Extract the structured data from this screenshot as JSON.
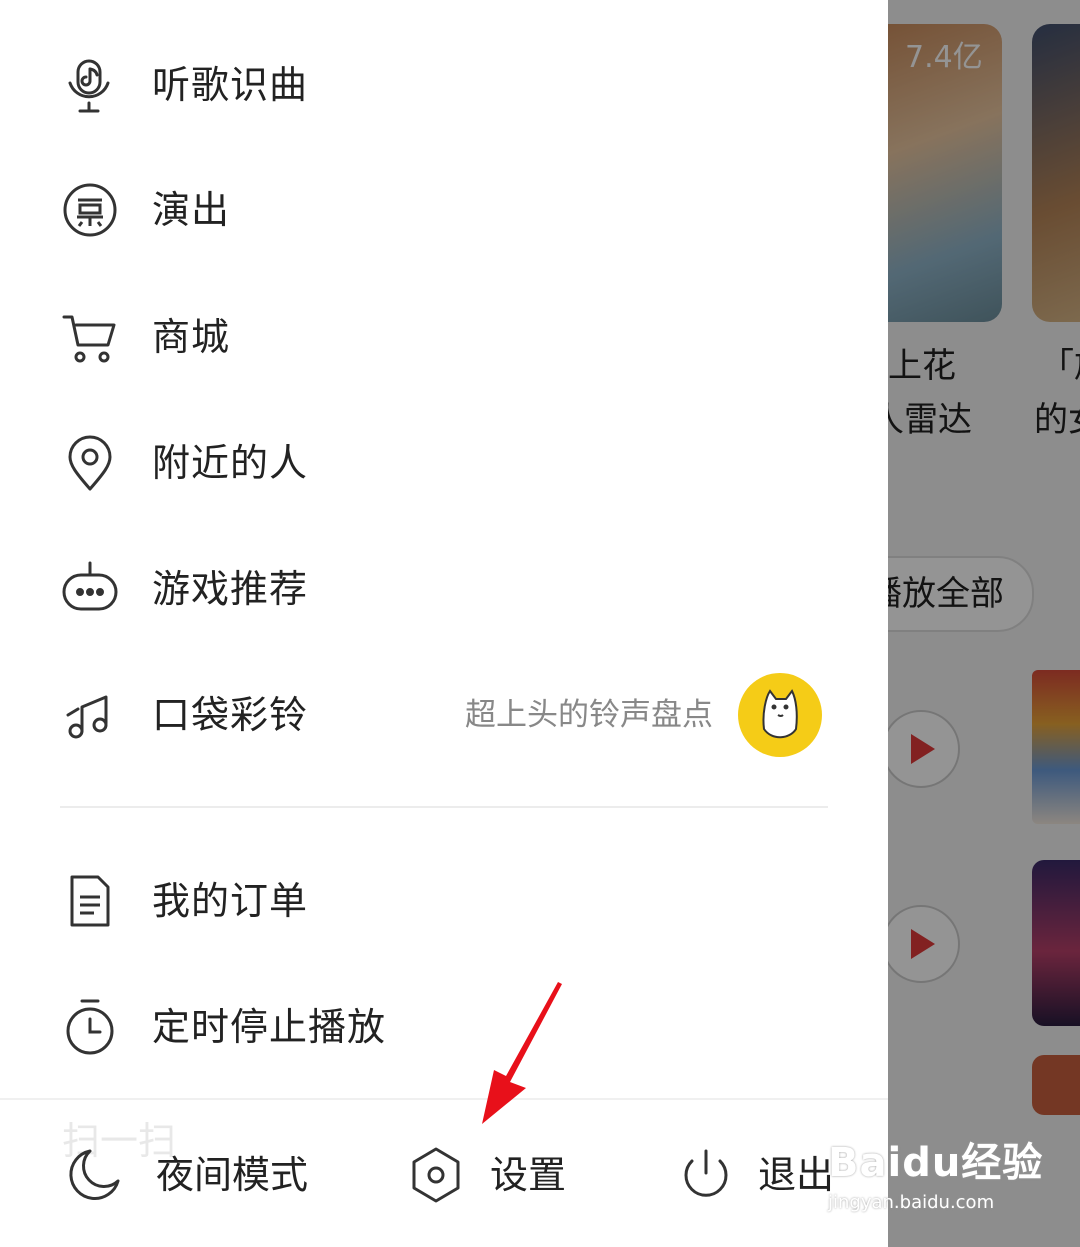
{
  "drawer": {
    "items": [
      {
        "label": "听歌识曲",
        "icon": "microphone-icon"
      },
      {
        "label": "演出",
        "icon": "ticket-icon"
      },
      {
        "label": "商城",
        "icon": "cart-icon"
      },
      {
        "label": "附近的人",
        "icon": "location-pin-icon"
      },
      {
        "label": "游戏推荐",
        "icon": "gamepad-icon"
      },
      {
        "label": "口袋彩铃",
        "icon": "music-note-icon",
        "subtitle": "超上头的铃声盘点"
      },
      {
        "label": "我的订单",
        "icon": "document-icon"
      },
      {
        "label": "定时停止播放",
        "icon": "timer-icon"
      }
    ],
    "bottom": {
      "night_mode": "夜间模式",
      "settings": "设置",
      "logout": "退出"
    },
    "ghost_text": "扫一扫"
  },
  "background": {
    "play_count": "7.4亿",
    "card1_line1": "上花",
    "card1_line2": "人雷达",
    "card2_line1": "「旅",
    "card2_line2": "的女",
    "play_all": "播放全部"
  },
  "watermark": {
    "brand": "Baidu经验",
    "url": "jingyan.baidu.com"
  },
  "colors": {
    "accent": "#e03a3a",
    "arrow": "#e8101a",
    "avatar_bg": "#f5cc17"
  }
}
